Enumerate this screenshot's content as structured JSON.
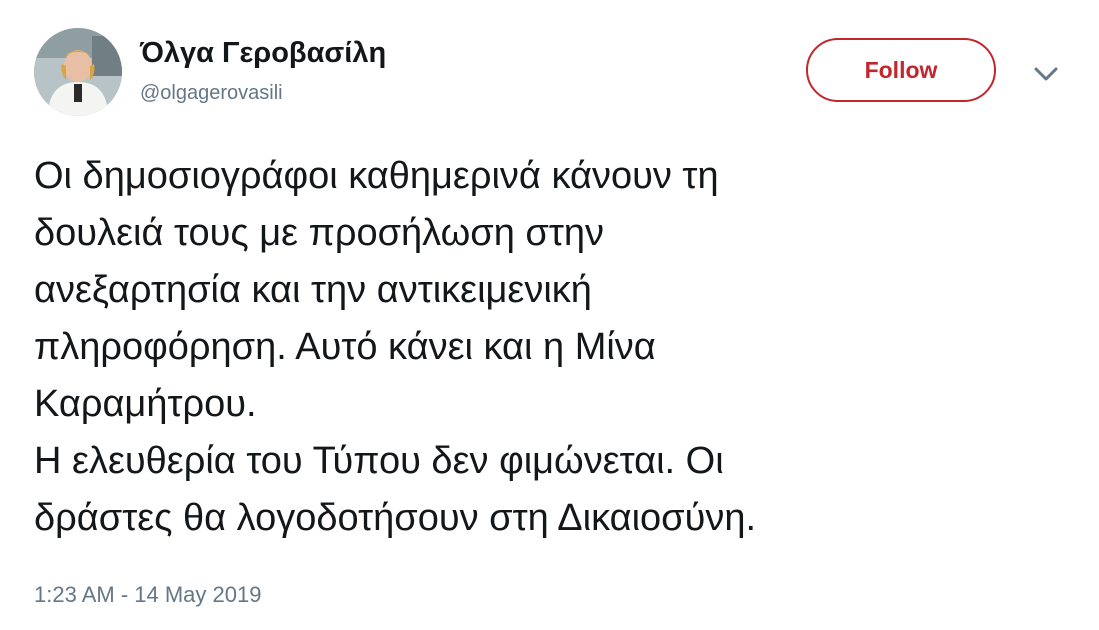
{
  "author": {
    "name": "Όλγα Γεροβασίλη",
    "handle": "@olgagerovasili",
    "avatar": "profile-photo"
  },
  "follow_button": {
    "label": "Follow",
    "color": "#c1272d"
  },
  "menu": {
    "icon": "chevron-down-icon"
  },
  "tweet": {
    "lines": [
      "Οι δημοσιογράφοι καθημερινά κάνουν τη",
      "δουλειά τους με προσήλωση στην",
      "ανεξαρτησία και την αντικειμενική",
      "πληροφόρηση. Αυτό κάνει και η Μίνα",
      "Καραμήτρου.",
      "Η ελευθερία του Τύπου δεν φιμώνεται. Οι",
      "δράστες θα λογοδοτήσουν στη Δικαιοσύνη."
    ]
  },
  "timestamp": "1:23 AM - 14 May 2019"
}
